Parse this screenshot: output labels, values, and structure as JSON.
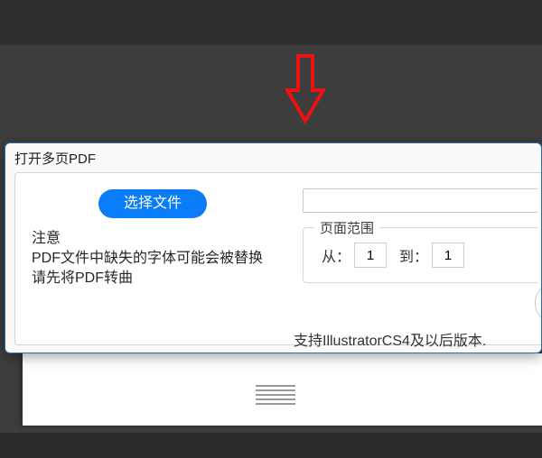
{
  "dialog": {
    "title": "打开多页PDF",
    "select_button": "选择文件",
    "file_path": "",
    "notice_heading": "注意",
    "notice_line1": "PDF文件中缺失的字体可能会被替换",
    "notice_line2": "请先将PDF转曲",
    "page_range_legend": "页面范围",
    "from_label": "从：",
    "to_label": "到：",
    "from_value": "1",
    "to_value": "1",
    "footer": "支持IllustratorCS4及以后版本."
  }
}
